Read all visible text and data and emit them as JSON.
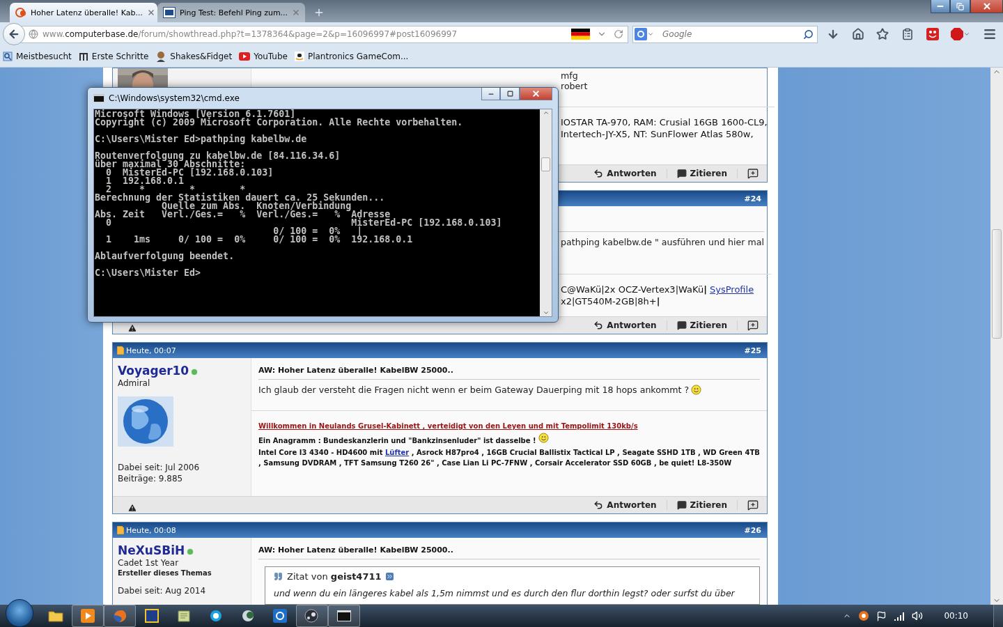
{
  "browser": {
    "tabs": [
      {
        "title": "Hoher Latenz überalle! Kab...",
        "selected": true
      },
      {
        "title": "Ping Test: Befehl Ping zum...",
        "selected": false
      }
    ],
    "address": {
      "prefix": "www.",
      "domain": "computerbase.de",
      "path": "/forum/showthread.php?t=1378364&page=2&p=16096997#post16096997"
    },
    "search": {
      "placeholder": "Google"
    },
    "bookmarks": [
      "Meistbesucht",
      "Erste Schritte",
      "Shakes&Fidget",
      "YouTube",
      "Plantronics GameCom..."
    ]
  },
  "forum": {
    "posts": [
      {
        "overlapped": true,
        "report": false,
        "avatar": {
          "kind": "picture"
        },
        "body": [
          {
            "text": "mfg"
          },
          {
            "text": "robert"
          }
        ],
        "signature": [
          {
            "kind": "plain",
            "text": "IOSTAR TA-970, RAM: Crusial 16GB 1600-CL9,"
          },
          {
            "kind": "plain",
            "text": "Intertech-JY-X5, NT: SunFlower Atlas 580w,"
          }
        ],
        "actions": [
          "Antworten",
          "Zitieren"
        ]
      },
      {
        "overlapped": true,
        "report": true,
        "header": {
          "number": "#24"
        },
        "body": [
          {
            "text": "pathping kabelbw.de \" ausführen und hier mal"
          }
        ],
        "signature": [
          {
            "kind": "plain",
            "text": "C@WaKü|2x OCZ-Vertex3|WaKü**|** ",
            "link": "SysProfile"
          },
          {
            "kind": "plain",
            "text": "x2|GT540M-2GB|8h+**|**"
          }
        ],
        "actions": [
          "Antworten",
          "Zitieren"
        ]
      },
      {
        "overlapped": false,
        "report": true,
        "header": {
          "date": "Heute, 00:07",
          "number": "#25"
        },
        "user": {
          "name": "Voyager10",
          "online": true,
          "rank": "Admiral",
          "joined": "Dabei seit: Jul 2006",
          "posts": "Beiträge: 9.885"
        },
        "avatar": {
          "kind": "picture"
        },
        "title": "AW: Hoher Latenz überalle! KabelBW 25000..",
        "body": [
          {
            "text": "Ich glaub der versteht die Fragen nicht wenn er beim Gateway Dauerping mit 18 hops ankommt ?",
            "smiley": true
          }
        ],
        "signature": [
          {
            "kind": "headline",
            "text": "Willkommen in Neulands Grusel-Kabinett , verteidigt von den Leyen und mit Tempolimit 130kb/s"
          },
          {
            "kind": "bold",
            "text": "Ein Anagramm : Bundeskanzlerin und \"Bankzinsenluder\" ist dasselbe !",
            "smiley": true
          },
          {
            "kind": "bold",
            "text": "Intel Core I3 4340 - HD4600 mit ",
            "link": "Lüfter",
            "after": " , Asrock H87pro4 , 16GB Crucial Ballistix Tactical LP , Seagate SSHD 1TB , WD Green 4TB , Samsung DVDRAM , TFT Samsung T260 26\" , Case Lian Li PC-7FNW , Corsair Accelerator SSD 60GB , be quiet! L8-350W"
          }
        ],
        "actions": [
          "Antworten",
          "Zitieren"
        ]
      },
      {
        "overlapped": false,
        "header": {
          "date": "Heute, 00:08",
          "number": "#26"
        },
        "user": {
          "name": "NeXuSBiH",
          "online": true,
          "rank": "Cadet 1st Year",
          "role": "Ersteller dieses Themas",
          "joined": "Dabei seit: Aug 2014"
        },
        "title": "AW: Hoher Latenz überalle! KabelBW 25000..",
        "quote": {
          "heading": "Zitat von **geist4711**",
          "text": "und wenn du ein längeres kabel als 1,5m nimmst und es durch den flur dorthin legst? oder surfst du über"
        }
      }
    ]
  },
  "console": {
    "title": "C:\\Windows\\system32\\cmd.exe",
    "output": "Microsoft Windows [Version 6.1.7601]\nCopyright (c) 2009 Microsoft Corporation. Alle Rechte vorbehalten.\n\nC:\\Users\\Mister Ed>pathping kabelbw.de\n\nRoutenverfolgung zu kabelbw.de [84.116.34.6]\nüber maximal 30 Abschnitte:\n  0  MisterEd-PC [192.168.0.103]\n  1  192.168.0.1\n  2     *        *        *\nBerechnung der Statistiken dauert ca. 25 Sekunden...\n            Quelle zum Abs.  Knoten/Verbindung\nAbs. Zeit   Verl./Ges.=   %  Verl./Ges.=   %  Adresse\n  0                                           MisterEd-PC [192.168.0.103]\n                                0/ 100 =  0%   |\n  1    1ms     0/ 100 =  0%     0/ 100 =  0%  192.168.0.1\n\nAblaufverfolgung beendet.\n\nC:\\Users\\Mister Ed>"
  },
  "taskbar": {
    "apps": [
      {
        "open": false
      },
      {
        "open": true
      },
      {
        "open": true
      },
      {
        "open": false
      },
      {
        "open": false
      },
      {
        "open": false
      },
      {
        "open": false
      },
      {
        "open": false
      },
      {
        "open": true
      },
      {
        "open": true
      }
    ],
    "clock": "00:10"
  }
}
